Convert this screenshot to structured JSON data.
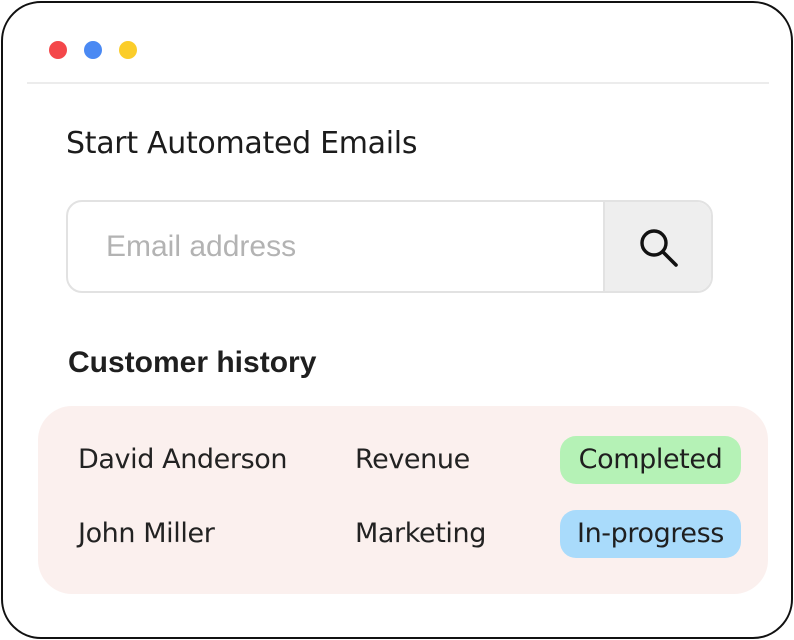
{
  "window": {
    "traffic_lights": [
      {
        "name": "close",
        "color": "#f4474a"
      },
      {
        "name": "maximize",
        "color": "#4a89f3"
      },
      {
        "name": "minimize",
        "color": "#fbcd2a"
      }
    ]
  },
  "main": {
    "heading": "Start Automated Emails",
    "search": {
      "placeholder": "Email address",
      "value": "",
      "button_icon": "search-icon"
    },
    "history": {
      "title": "Customer history",
      "rows": [
        {
          "name": "David Anderson",
          "department": "Revenue",
          "status": "Completed",
          "status_color": "#b5f2b6"
        },
        {
          "name": "John Miller",
          "department": "Marketing",
          "status": "In-progress",
          "status_color": "#a9dbfb"
        }
      ],
      "background_color": "#fbf0ee"
    }
  }
}
